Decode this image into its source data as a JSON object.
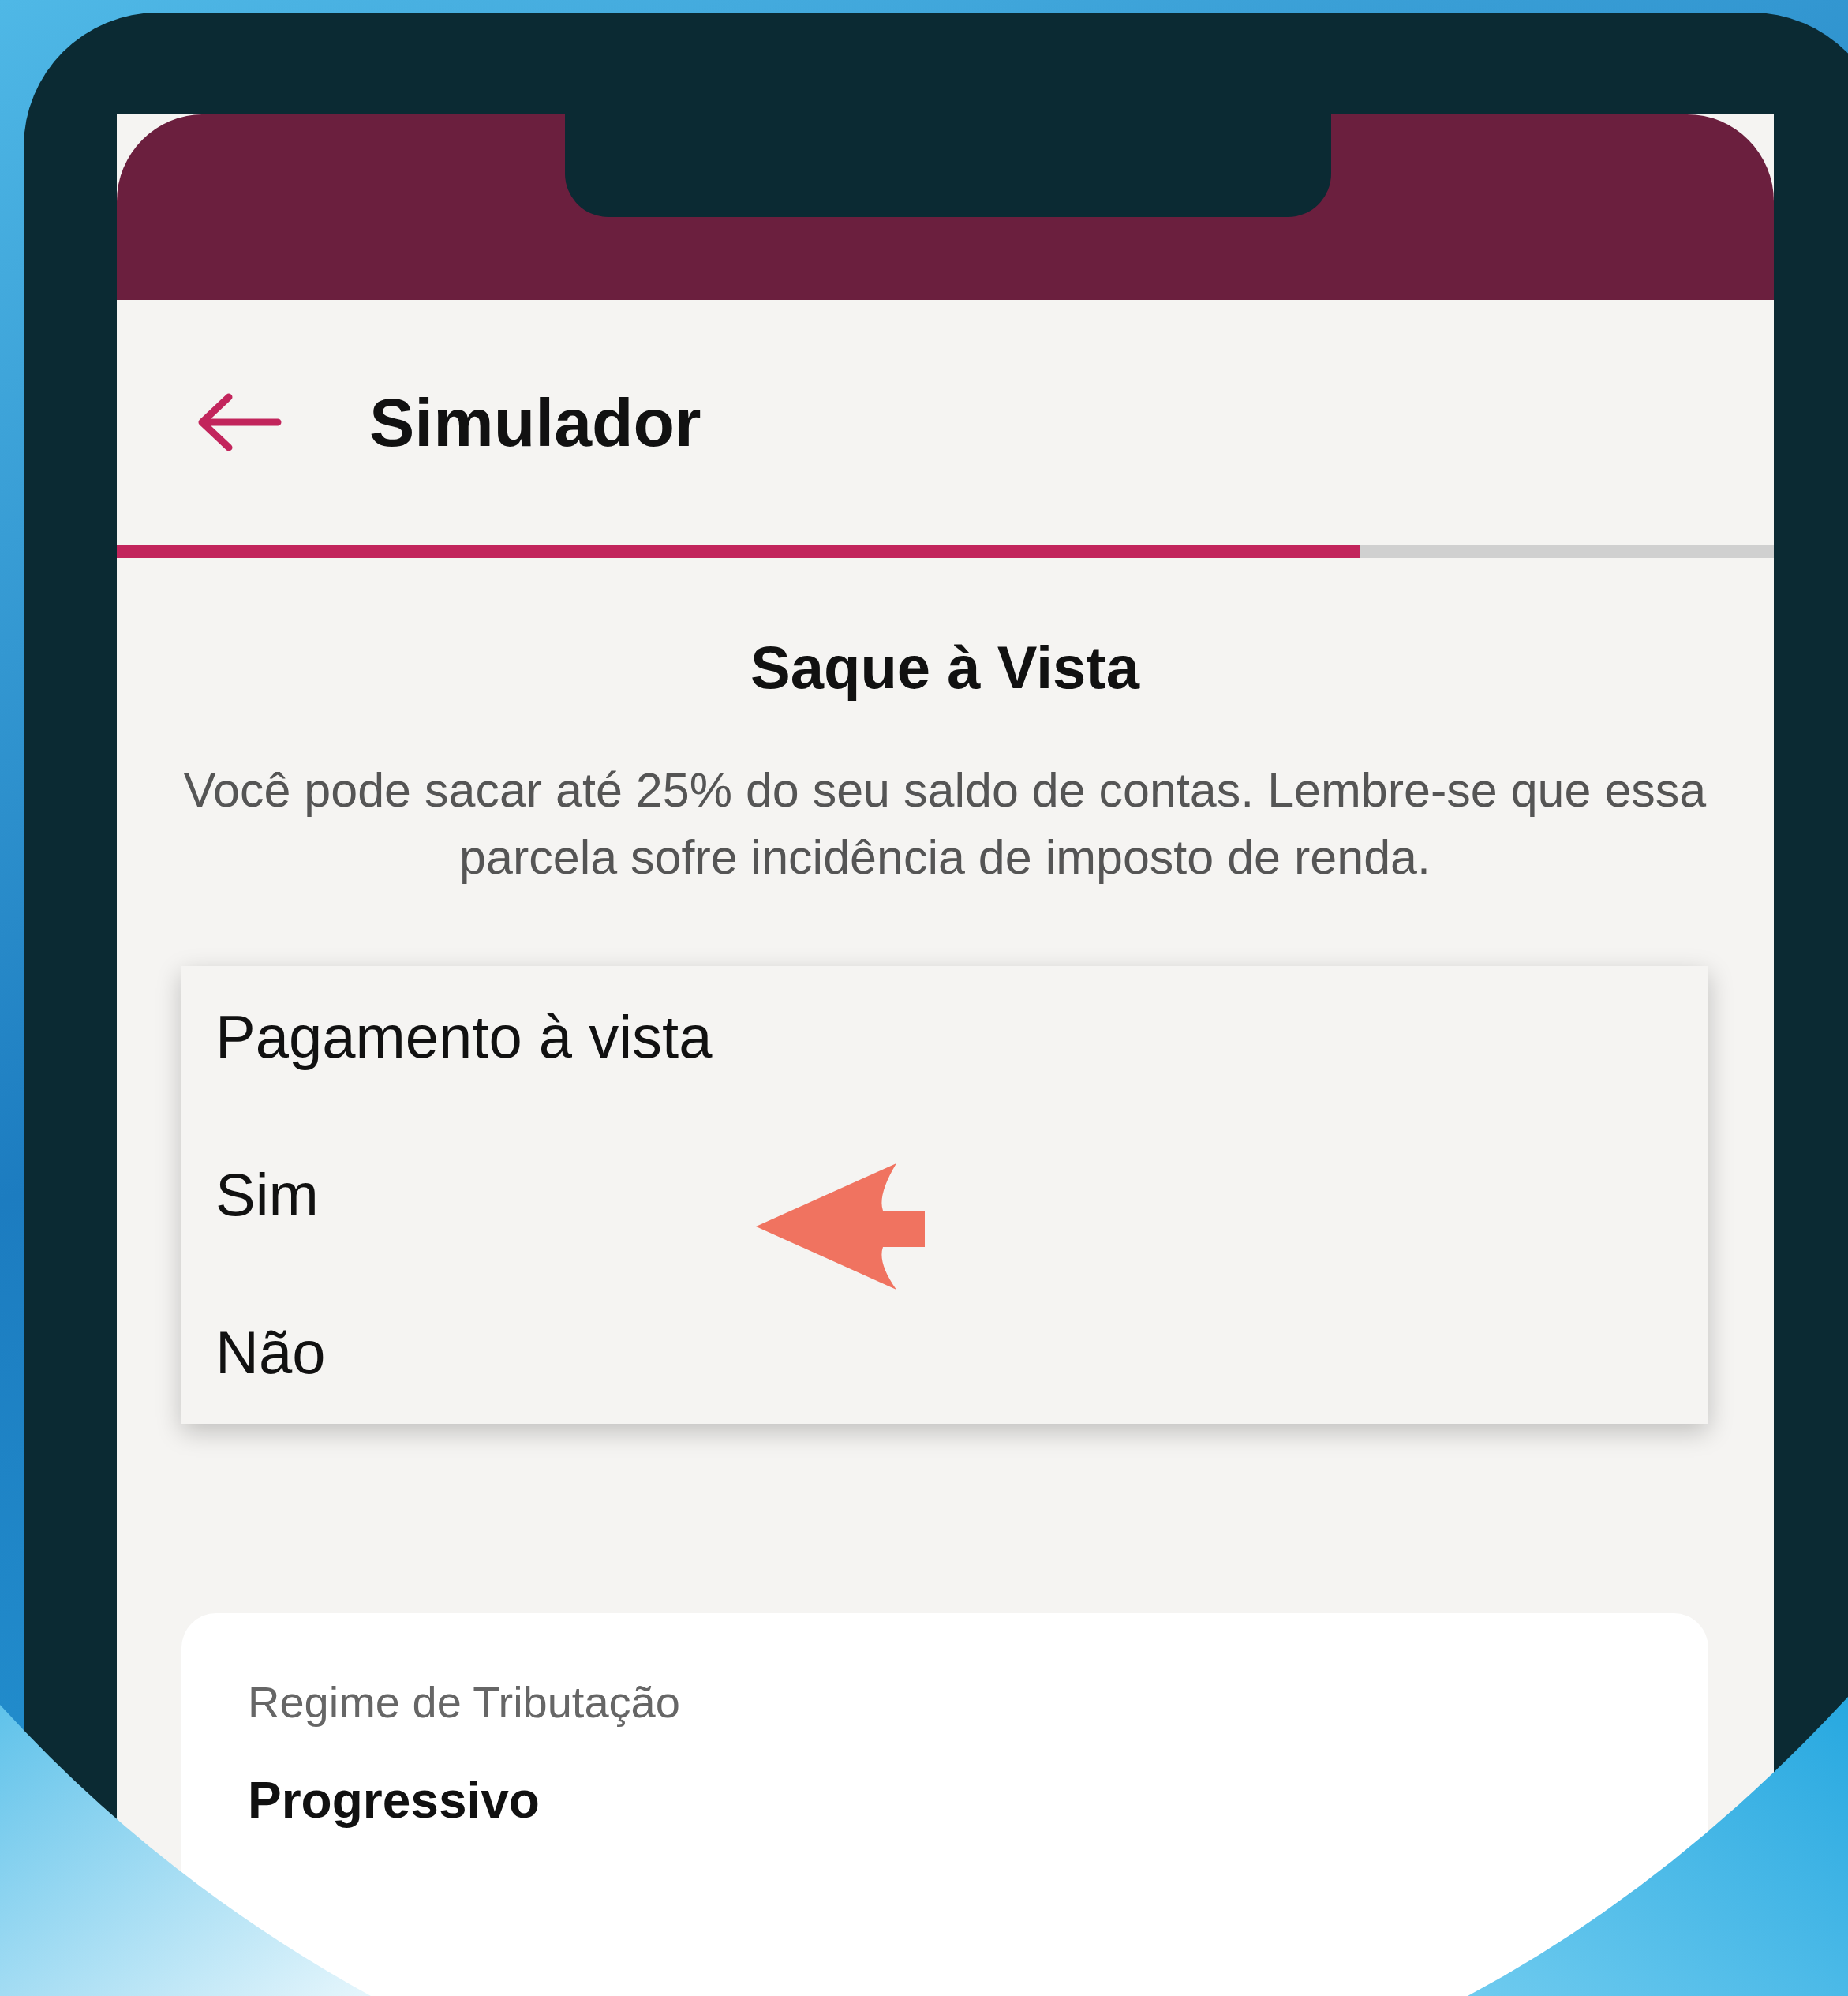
{
  "header": {
    "title": "Simulador"
  },
  "progress": {
    "level": 0.75
  },
  "section": {
    "title": "Saque à Vista",
    "description": "Você pode sacar até 25% do seu saldo de contas. Lembre-se que essa parcela sofre incidência de imposto de renda."
  },
  "menu": {
    "label": "Pagamento à vista",
    "options": [
      {
        "label": "Sim"
      },
      {
        "label": "Não"
      }
    ]
  },
  "field": {
    "label": "Regime de Tributação",
    "value": "Progressivo"
  }
}
